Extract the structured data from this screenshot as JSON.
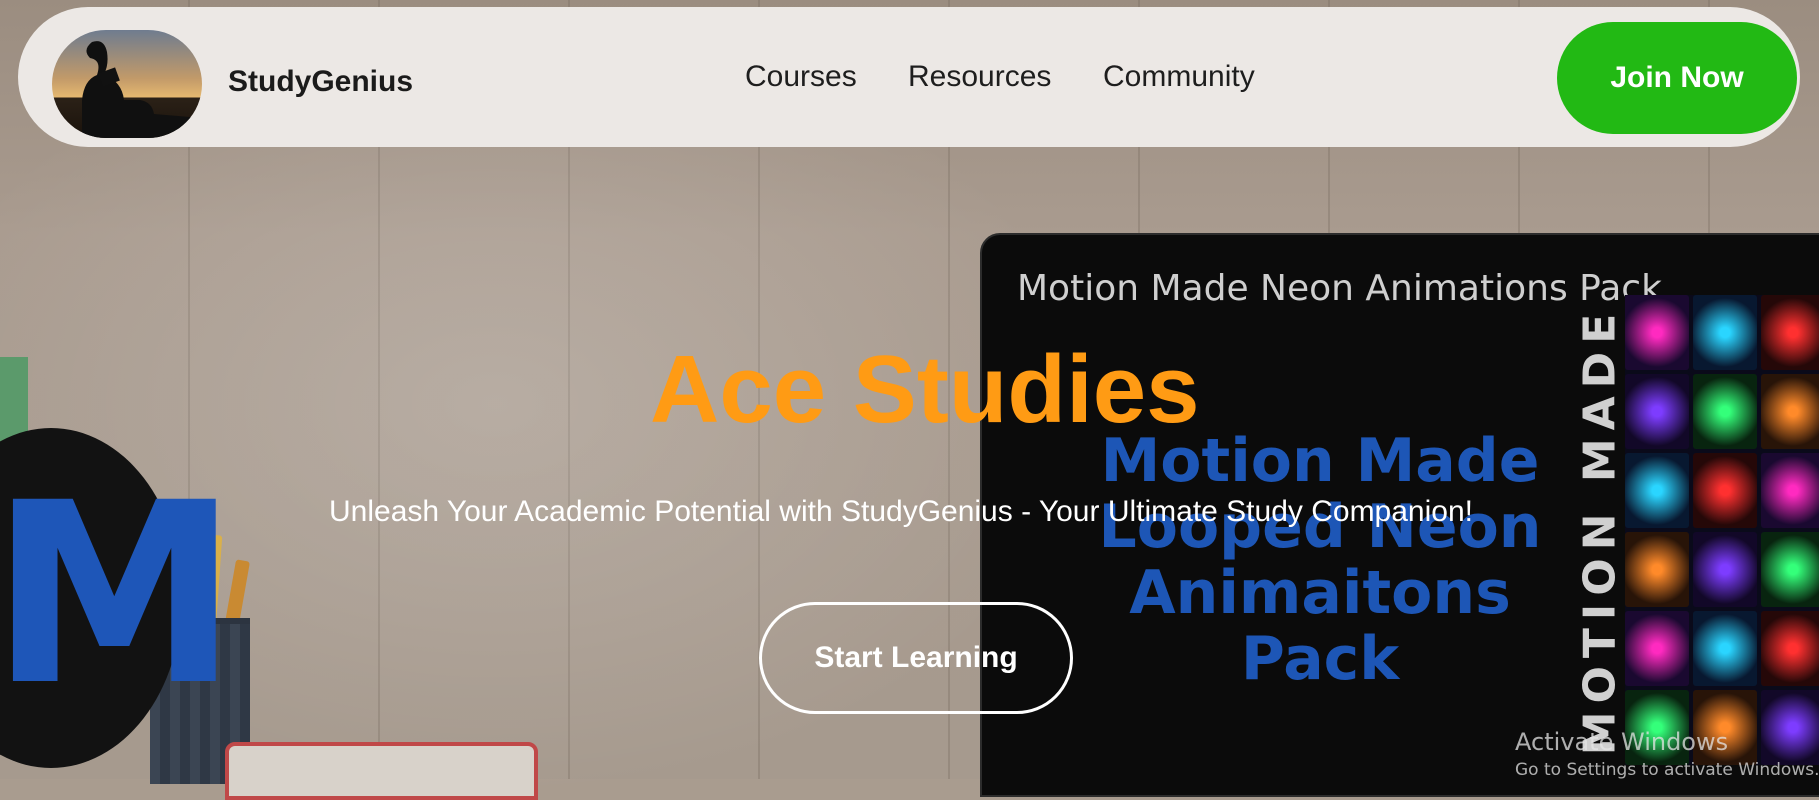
{
  "navbar": {
    "brand": "StudyGenius",
    "links": [
      "Courses",
      "Resources",
      "Community"
    ],
    "cta_label": "Join Now",
    "cta_color": "#22b914"
  },
  "hero": {
    "title": "Ace Studies",
    "title_color": "#ff9b14",
    "subtitle": "Unleash Your Academic Potential with StudyGenius - Your Ultimate Study Companion!",
    "cta_label": "Start Learning"
  },
  "video_overlay": {
    "title": "Motion Made Neon Animations Pack",
    "big_text": "Motion Made Looped Neon Animaitons Pack",
    "vertical_text": "MOTION MADE",
    "big_text_color": "#1d56b6"
  },
  "background": {
    "letter": "M"
  },
  "windows_watermark": {
    "line1": "Activate Windows",
    "line2": "Go to Settings to activate Windows."
  }
}
